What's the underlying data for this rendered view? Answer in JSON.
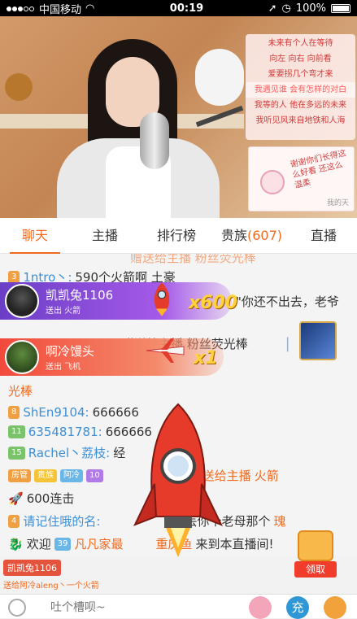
{
  "status_bar": {
    "carrier": "中国移动",
    "time": "00:19",
    "battery": "100%"
  },
  "lyrics": [
    "未来有个人在等待",
    "向左 向右 向前看",
    "爱要拐几个弯才来",
    "我遇见谁 会有怎样的对白",
    "我等的人 他在多远的未来",
    "我听见风来自地铁和人海"
  ],
  "card_text": "谢谢你们长得这么好看\n还这么温柔",
  "card_watermark": "我的天",
  "tabs": [
    {
      "label": "聊天",
      "active": true
    },
    {
      "label": "主播",
      "active": false
    },
    {
      "label": "排行榜",
      "active": false
    },
    {
      "label": "贵族",
      "count": "(607)",
      "active": false
    },
    {
      "label": "直播",
      "active": false
    }
  ],
  "chat": {
    "row_top": "赠送给主播  粉丝荧光棒",
    "row1_user": "1ntro丶:",
    "row1_msg": "590个火箭啊 土豪",
    "row_quote": "\"你还不出去，老爷",
    "row_mid": "赠送给主播  粉丝荧光棒",
    "row_mid2": "光棒",
    "row2_user": "ShEn9104:",
    "row2_msg": "666666",
    "row3_user": "635481781:",
    "row3_msg": "666666",
    "row4_user": "Rachel丶荔枝:",
    "row4_msg": "经",
    "row4_tail": "吧",
    "row5_badge1": "房管",
    "row5_badge2": "贵族",
    "row5_badge3": "阿冷",
    "row5_level": "10",
    "row5_text": "1106  赠送给主播",
    "row5_gift": "火箭",
    "row6_msg": "600连击",
    "row7_user": "请记住哦的名:",
    "row7_msg": "丢你个老母那个",
    "row7_tail": "瑰",
    "row8_welcome": "欢迎",
    "row8_level": "39",
    "row8_name": "凡凡家最",
    "row8_name2": "重庆鱼",
    "row8_msg": "来到本直播间!",
    "levels": [
      "3",
      "8",
      "4",
      "11",
      "15",
      "4"
    ]
  },
  "banner1": {
    "user": "凯凯兔1106",
    "gift": "送出 火箭",
    "combo": "x600"
  },
  "banner2": {
    "user": "啊冷馒头",
    "gift": "送出 飞机",
    "combo": "x1"
  },
  "notice": {
    "user": "凯凯兔1106",
    "text": "送给阿冷aleng丶一个火箭"
  },
  "receive_label": "领取",
  "input_placeholder": "吐个槽呗~",
  "charge_label": "充",
  "colors": {
    "accent": "#f06a1f",
    "banner_purple": "#6b3ec7",
    "banner_red": "#f24a3c"
  }
}
